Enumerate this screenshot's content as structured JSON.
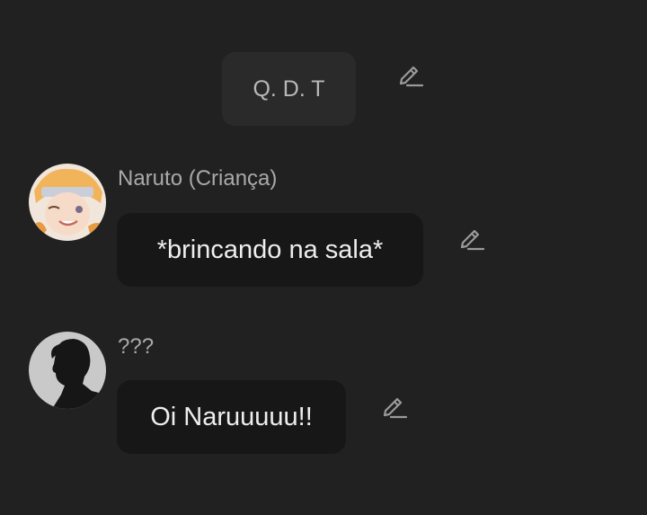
{
  "narration": {
    "text": "Q. D. T"
  },
  "messages": [
    {
      "character": "Naruto (Criança)",
      "text": "*brincando na sala*"
    },
    {
      "character": "???",
      "text": "Oi Naruuuuu!!"
    }
  ],
  "icons": {
    "edit": "pencil-edit-icon",
    "avatar_1": "blond-child-avatar",
    "avatar_2": "silhouette-avatar"
  },
  "colors": {
    "background": "#212121",
    "narration_bubble": "#2a2a2a",
    "message_bubble": "#171717",
    "name_text": "#a9a9a9",
    "message_text": "#eeeeee"
  }
}
